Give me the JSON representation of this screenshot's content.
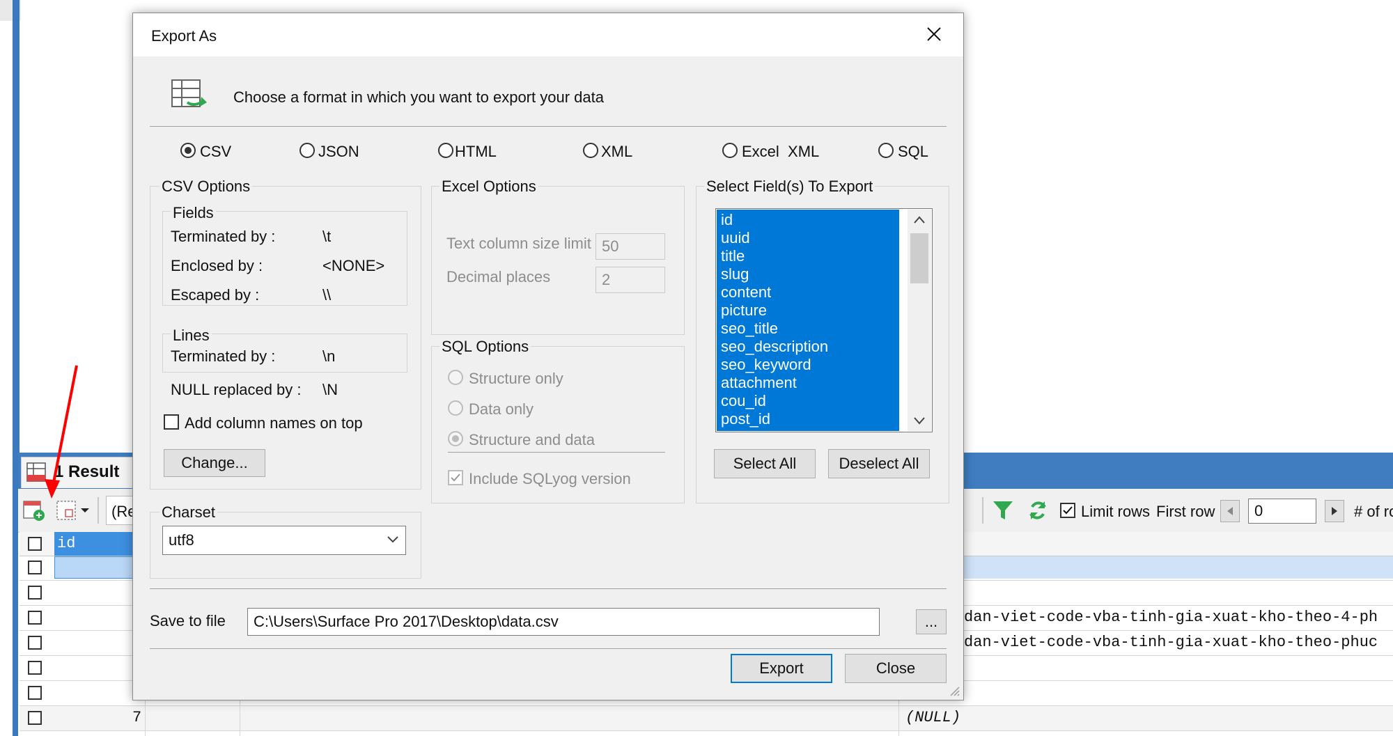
{
  "dialog": {
    "title": "Export As",
    "header_text": "Choose a format in which you want to export your data",
    "formats": [
      {
        "label": "CSV",
        "checked": true
      },
      {
        "label": "JSON",
        "checked": false
      },
      {
        "label": "HTML",
        "checked": false
      },
      {
        "label": "XML",
        "checked": false
      },
      {
        "label": "Excel  XML",
        "checked": false
      },
      {
        "label": "SQL",
        "checked": false
      }
    ],
    "csv": {
      "group_label": "CSV Options",
      "fields_label": "Fields",
      "terminated_label": "Terminated by :",
      "terminated_value": "\\t",
      "enclosed_label": "Enclosed by :",
      "enclosed_value": "<NONE>",
      "escaped_label": "Escaped by :",
      "escaped_value": "\\\\",
      "lines_label": "Lines",
      "lines_terminated_label": "Terminated by :",
      "lines_terminated_value": "\\n",
      "null_label": "NULL replaced by :",
      "null_value": "\\N",
      "add_columns_label": "Add column names on top",
      "change_button": "Change..."
    },
    "excel": {
      "group_label": "Excel Options",
      "text_limit_label": "Text column size limit",
      "text_limit_value": "50",
      "decimal_label": "Decimal places",
      "decimal_value": "2"
    },
    "sql": {
      "group_label": "SQL Options",
      "structure_only": "Structure only",
      "data_only": "Data only",
      "structure_and_data": "Structure and data",
      "include_version": "Include SQLyog version"
    },
    "fields": {
      "group_label": "Select Field(s) To Export",
      "items": [
        "id",
        "uuid",
        "title",
        "slug",
        "content",
        "picture",
        "seo_title",
        "seo_description",
        "seo_keyword",
        "attachment",
        "cou_id",
        "post_id"
      ],
      "select_all": "Select All",
      "deselect_all": "Deselect All"
    },
    "charset": {
      "label": "Charset",
      "value": "utf8"
    },
    "save": {
      "label": "Save to file",
      "path": "C:\\Users\\Surface Pro 2017\\Desktop\\data.csv",
      "browse": "..."
    },
    "export_button": "Export",
    "close_button": "Close"
  },
  "background": {
    "result_tab": "1 Result",
    "toolbar_filter_text": "(Re",
    "limit_rows_label": "Limit rows",
    "first_row_label": "First row",
    "first_row_value": "0",
    "rows_label": "# of ro",
    "column_header": "id",
    "row7_number": "7",
    "null_text": "(NULL)",
    "slug_row1": "dan-viet-code-vba-tinh-gia-xuat-kho-theo-4-ph",
    "slug_row2": "dan-viet-code-vba-tinh-gia-xuat-kho-theo-phuc"
  },
  "colors": {
    "accent": "#0078d7",
    "app_blue": "#3f7cc0",
    "arrow": "#ff0000"
  }
}
